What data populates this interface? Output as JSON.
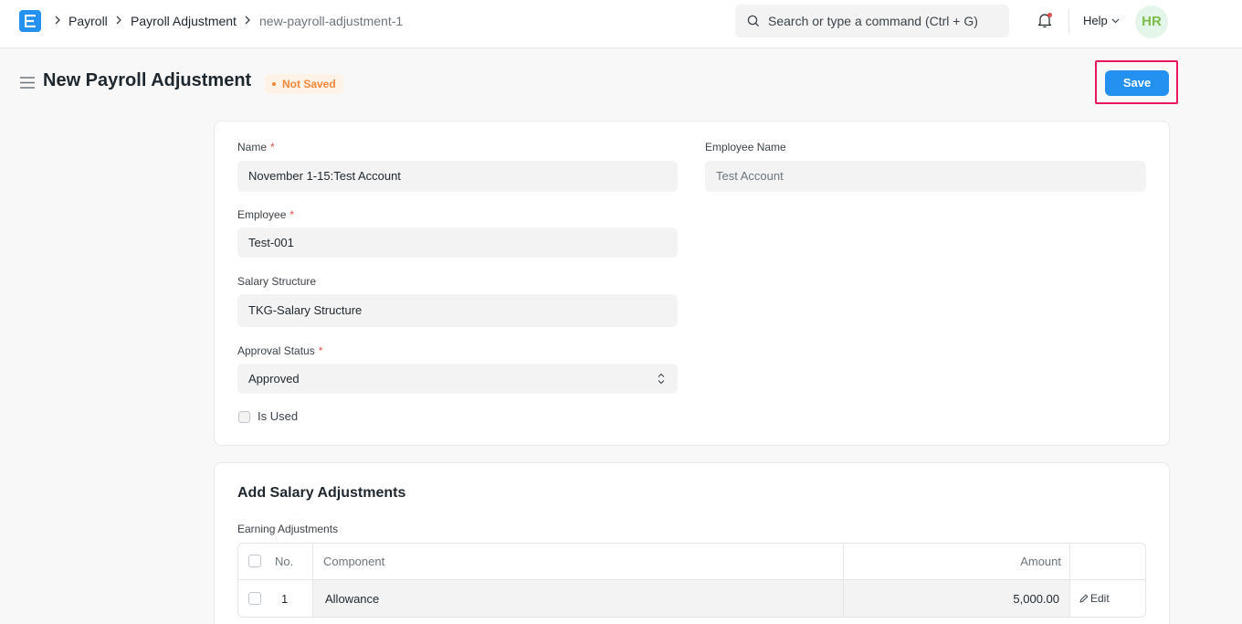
{
  "navbar": {
    "logo_letter": "E",
    "breadcrumbs": [
      "Payroll",
      "Payroll Adjustment",
      "new-payroll-adjustment-1"
    ],
    "search_placeholder": "Search or type a command (Ctrl + G)",
    "help_label": "Help",
    "avatar_initials": "HR"
  },
  "header": {
    "title": "New Payroll Adjustment",
    "status": "Not Saved",
    "save_label": "Save"
  },
  "form": {
    "name": {
      "label": "Name",
      "required": "*",
      "value": "November 1-15:Test Account"
    },
    "employee_name": {
      "label": "Employee Name",
      "value": "Test Account"
    },
    "employee": {
      "label": "Employee",
      "required": "*",
      "value": "Test-001"
    },
    "salary_structure": {
      "label": "Salary Structure",
      "value": "TKG-Salary Structure"
    },
    "approval_status": {
      "label": "Approval Status",
      "required": "*",
      "value": "Approved"
    },
    "is_used": {
      "label": "Is Used",
      "checked": false
    }
  },
  "adjustments": {
    "section_title": "Add Salary Adjustments",
    "table_label": "Earning Adjustments",
    "columns": {
      "no": "No.",
      "component": "Component",
      "amount": "Amount"
    },
    "rows": [
      {
        "no": "1",
        "component": "Allowance",
        "amount": "5,000.00",
        "edit_label": "Edit"
      }
    ]
  },
  "colors": {
    "accent": "#2490ef",
    "status_orange": "#f5863a",
    "highlight": "#e8185e"
  }
}
